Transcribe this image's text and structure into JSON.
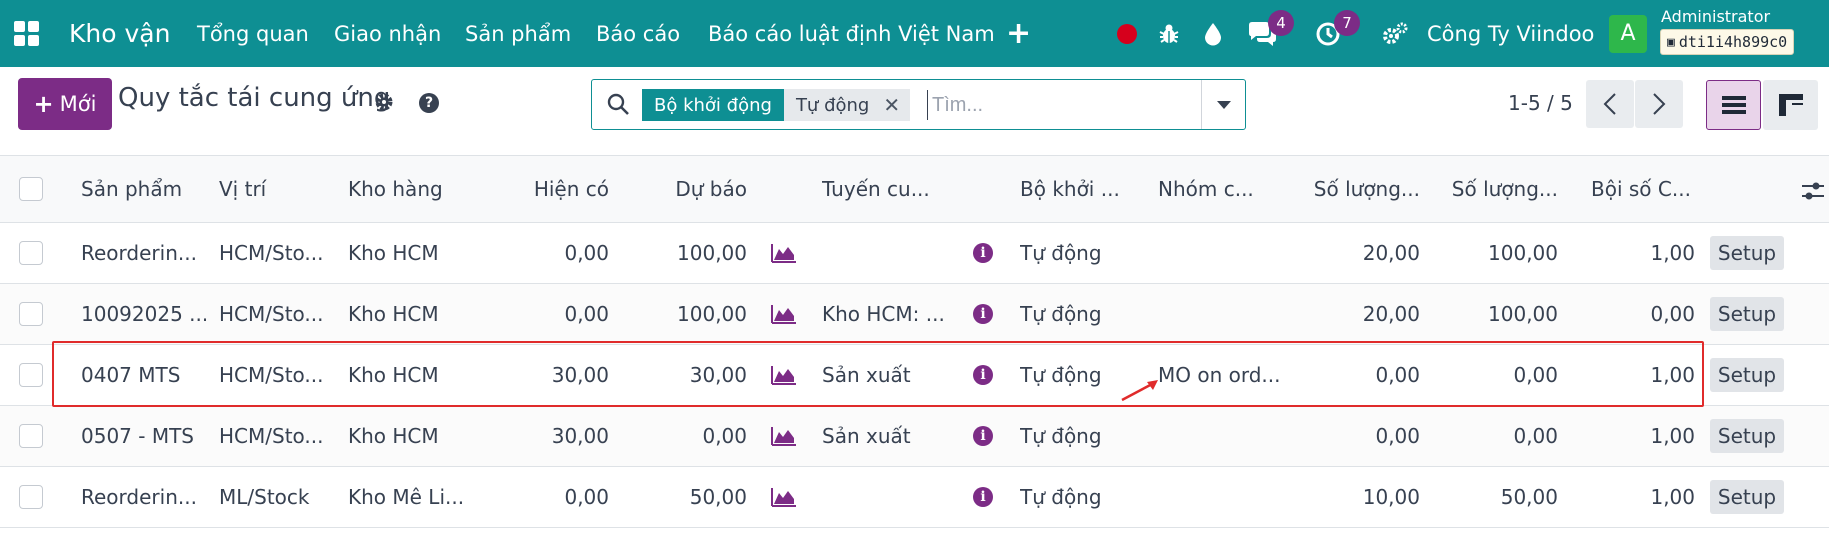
{
  "nav": {
    "brand": "Kho vận",
    "menu": [
      "Tổng quan",
      "Giao nhận",
      "Sản phẩm",
      "Báo cáo",
      "Báo cáo luật định Việt Nam"
    ],
    "messages_count": "4",
    "activities_count": "7",
    "company": "Công Ty Viindoo",
    "avatar_letter": "A",
    "user_name": "Administrator",
    "database": "dti1i4h899c0"
  },
  "control": {
    "new_label": "Mới",
    "title": "Quy tắc tái cung ứng",
    "facet_label": "Bộ khởi động",
    "facet_value": "Tự động",
    "search_placeholder": "Tìm...",
    "pager": "1-5 / 5"
  },
  "columns": {
    "product": "Sản phẩm",
    "location": "Vị trí",
    "warehouse": "Kho hàng",
    "on_hand": "Hiện có",
    "forecast": "Dự báo",
    "route": "Tuyến cu...",
    "trigger": "Bộ khởi ...",
    "group": "Nhóm c...",
    "min_qty": "Số lượng...",
    "max_qty": "Số lượng...",
    "multiple": "Bội số C..."
  },
  "rows": [
    {
      "product": "Reorderin...",
      "location": "HCM/Sto...",
      "warehouse": "Kho HCM",
      "on_hand": "0,00",
      "forecast": "100,00",
      "route": "",
      "trigger": "Tự động",
      "group": "",
      "min_qty": "20,00",
      "max_qty": "100,00",
      "multiple": "1,00",
      "setup": "Setup"
    },
    {
      "product": "10092025 ...",
      "location": "HCM/Sto...",
      "warehouse": "Kho HCM",
      "on_hand": "0,00",
      "forecast": "100,00",
      "route": "Kho HCM: ...",
      "trigger": "Tự động",
      "group": "",
      "min_qty": "20,00",
      "max_qty": "100,00",
      "multiple": "0,00",
      "setup": "Setup"
    },
    {
      "product": "0407 MTS",
      "location": "HCM/Sto...",
      "warehouse": "Kho HCM",
      "on_hand": "30,00",
      "forecast": "30,00",
      "route": "Sản xuất",
      "trigger": "Tự động",
      "group": "MO on ord...",
      "min_qty": "0,00",
      "max_qty": "0,00",
      "multiple": "1,00",
      "setup": "Setup"
    },
    {
      "product": "0507 - MTS",
      "location": "HCM/Sto...",
      "warehouse": "Kho HCM",
      "on_hand": "30,00",
      "forecast": "0,00",
      "route": "Sản xuất",
      "trigger": "Tự động",
      "group": "",
      "min_qty": "0,00",
      "max_qty": "0,00",
      "multiple": "1,00",
      "setup": "Setup"
    },
    {
      "product": "Reorderin...",
      "location": "ML/Stock",
      "warehouse": "Kho Mê Li...",
      "on_hand": "0,00",
      "forecast": "50,00",
      "route": "",
      "trigger": "Tự động",
      "group": "",
      "min_qty": "10,00",
      "max_qty": "50,00",
      "multiple": "1,00",
      "setup": "Setup"
    }
  ],
  "colors": {
    "navbar": "#0e8f93",
    "primary": "#7c2c86",
    "annotation": "#e02b2b"
  }
}
